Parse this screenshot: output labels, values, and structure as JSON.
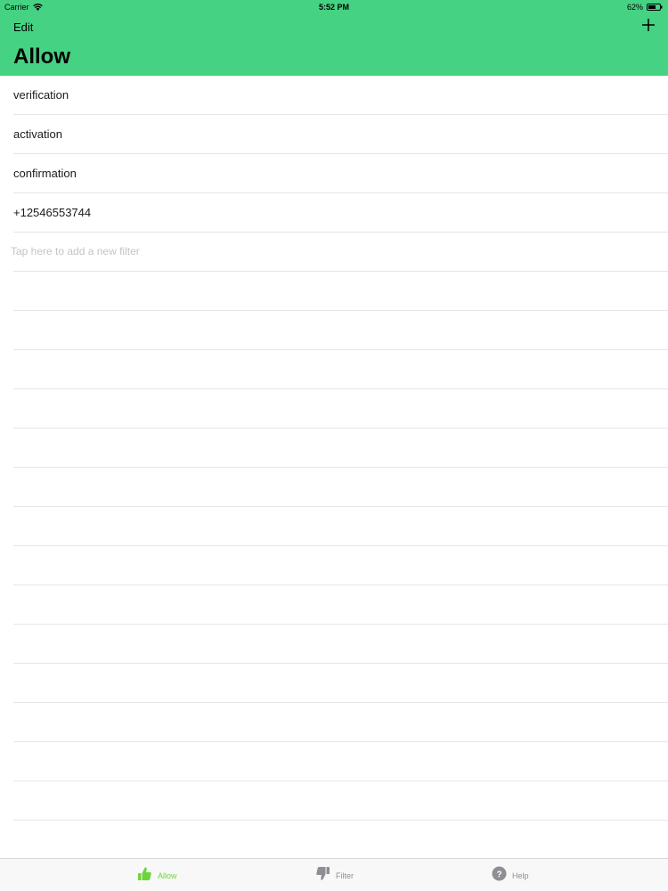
{
  "status_bar": {
    "carrier": "Carrier",
    "time": "5:52 PM",
    "battery": "62%"
  },
  "nav": {
    "edit_label": "Edit",
    "add_icon": "plus-icon",
    "title": "Allow"
  },
  "filters": [
    "verification",
    "activation",
    "confirmation",
    "+12546553744"
  ],
  "add_placeholder": "Tap here to add a new filter",
  "tabs": {
    "allow": {
      "label": "Allow",
      "icon": "thumbs-up-icon"
    },
    "filter": {
      "label": "Filter",
      "icon": "thumbs-down-icon"
    },
    "help": {
      "label": "Help",
      "icon": "question-icon"
    }
  },
  "colors": {
    "header_bg": "#45d282",
    "tab_active": "#6dd43a",
    "tab_inactive": "#8e8e93"
  }
}
